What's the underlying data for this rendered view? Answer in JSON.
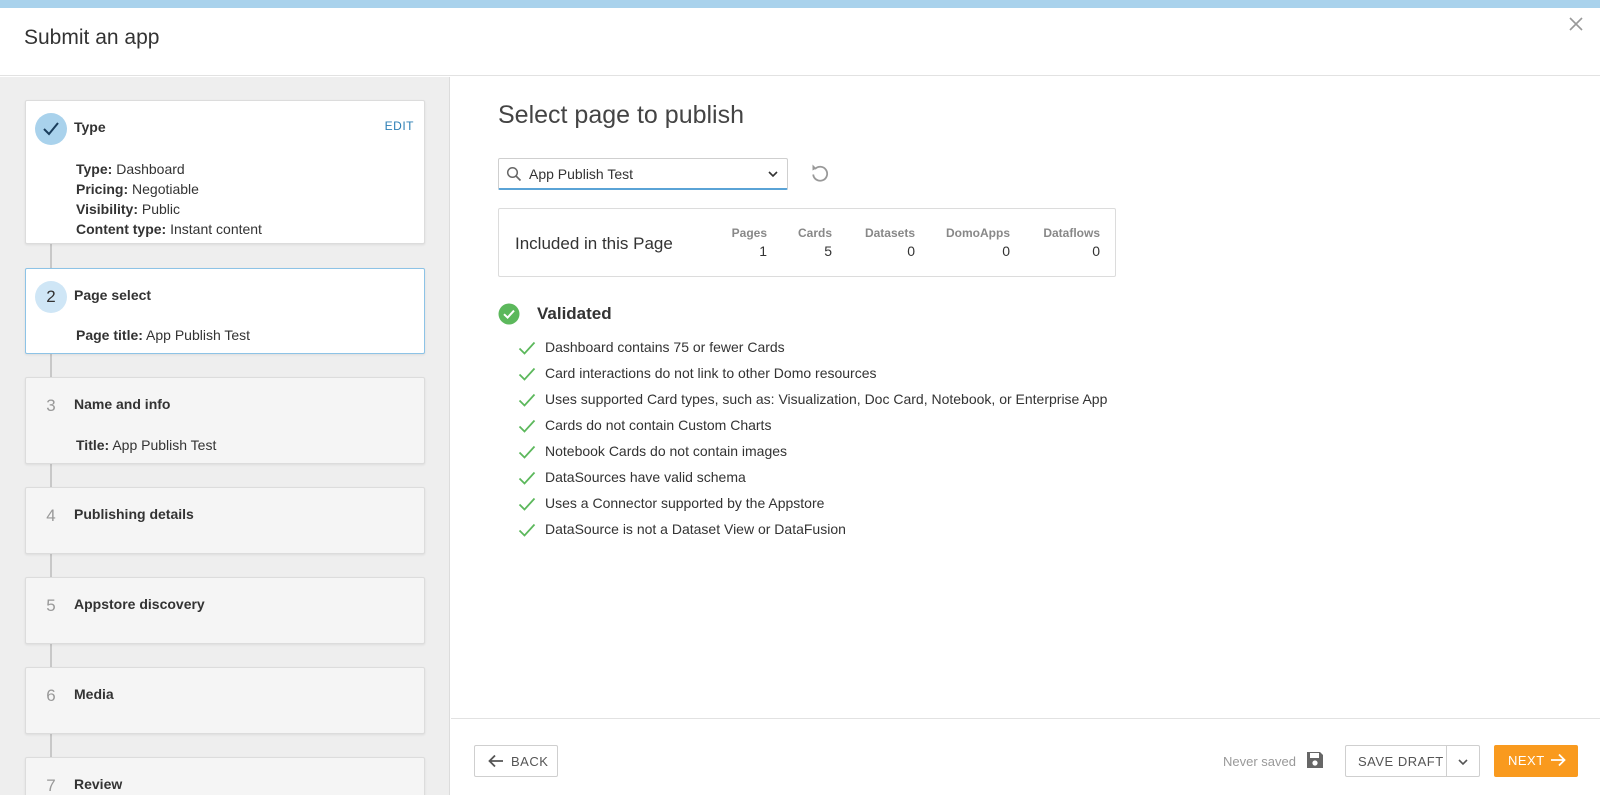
{
  "header": {
    "title": "Submit an app"
  },
  "steps": [
    {
      "num": "",
      "title": "Type",
      "edit_label": "EDIT",
      "details": [
        {
          "label": "Type:",
          "value": "Dashboard"
        },
        {
          "label": "Pricing:",
          "value": "Negotiable"
        },
        {
          "label": "Visibility:",
          "value": "Public"
        },
        {
          "label": "Content type:",
          "value": "Instant content"
        }
      ]
    },
    {
      "num": "2",
      "title": "Page select",
      "details": [
        {
          "label": "Page title:",
          "value": "App Publish Test"
        }
      ]
    },
    {
      "num": "3",
      "title": "Name and info",
      "details": [
        {
          "label": "Title:",
          "value": "App Publish Test"
        }
      ]
    },
    {
      "num": "4",
      "title": "Publishing details"
    },
    {
      "num": "5",
      "title": "Appstore discovery"
    },
    {
      "num": "6",
      "title": "Media"
    },
    {
      "num": "7",
      "title": "Review"
    }
  ],
  "main": {
    "title": "Select page to publish",
    "page_select": {
      "value": "App Publish Test"
    },
    "summary": {
      "title": "Included in this Page",
      "stats": [
        {
          "label": "Pages",
          "value": "1"
        },
        {
          "label": "Cards",
          "value": "5"
        },
        {
          "label": "Datasets",
          "value": "0"
        },
        {
          "label": "DomoApps",
          "value": "0"
        },
        {
          "label": "Dataflows",
          "value": "0"
        }
      ]
    },
    "validated_label": "Validated",
    "checks": [
      "Dashboard contains 75 or fewer Cards",
      "Card interactions do not link to other Domo resources",
      "Uses supported Card types, such as: Visualization, Doc Card, Notebook, or Enterprise App",
      "Cards do not contain Custom Charts",
      "Notebook Cards do not contain images",
      "DataSources have valid schema",
      "Uses a Connector supported by the Appstore",
      "DataSource is not a Dataset View or DataFusion"
    ]
  },
  "footer": {
    "back_label": "BACK",
    "save_status": "Never saved",
    "save_draft_label": "SAVE DRAFT",
    "next_label": "NEXT"
  },
  "colors": {
    "accent": "#f99a1e",
    "check": "#5cb85c",
    "link": "#2d7fb5",
    "step_done": "#a9d2ec"
  }
}
